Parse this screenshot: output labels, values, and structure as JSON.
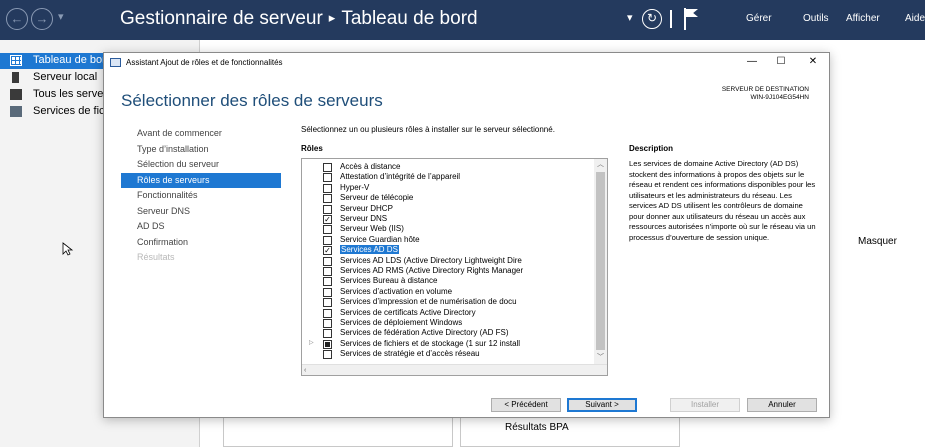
{
  "header": {
    "title_app": "Gestionnaire de serveur",
    "title_separator": "▸",
    "title_page": "Tableau de bord",
    "menu": [
      "Gérer",
      "Outils",
      "Afficher",
      "Aide"
    ]
  },
  "left_nav": {
    "items": [
      {
        "label": "Tableau de bord",
        "active": true,
        "icon": "dashboard-icon"
      },
      {
        "label": "Serveur local",
        "active": false,
        "icon": "server-icon"
      },
      {
        "label": "Tous les serveurs",
        "active": false,
        "icon": "servers-icon"
      },
      {
        "label": "Services de fichiers et de stockage",
        "active": false,
        "icon": "file-services-icon"
      }
    ]
  },
  "background": {
    "hide_label": "Masquer",
    "bpa_label": "Résultats BPA"
  },
  "dialog": {
    "title": "Assistant Ajout de rôles et de fonctionnalités",
    "heading": "Sélectionner des rôles de serveurs",
    "destination_label": "SERVEUR DE DESTINATION",
    "destination_server": "WIN-9J104EG54HN",
    "steps": [
      {
        "label": "Avant de commencer",
        "state": "normal"
      },
      {
        "label": "Type d’installation",
        "state": "normal"
      },
      {
        "label": "Sélection du serveur",
        "state": "normal"
      },
      {
        "label": "Rôles de serveurs",
        "state": "active"
      },
      {
        "label": "Fonctionnalités",
        "state": "normal"
      },
      {
        "label": "Serveur DNS",
        "state": "normal"
      },
      {
        "label": "AD DS",
        "state": "normal"
      },
      {
        "label": "Confirmation",
        "state": "normal"
      },
      {
        "label": "Résultats",
        "state": "disabled"
      }
    ],
    "instruction": "Sélectionnez un ou plusieurs rôles à installer sur le serveur sélectionné.",
    "roles_label": "Rôles",
    "roles": [
      {
        "label": "Accès à distance",
        "checked": false
      },
      {
        "label": "Attestation d’intégrité de l’appareil",
        "checked": false
      },
      {
        "label": "Hyper-V",
        "checked": false
      },
      {
        "label": "Serveur de télécopie",
        "checked": false
      },
      {
        "label": "Serveur DHCP",
        "checked": false
      },
      {
        "label": "Serveur DNS",
        "checked": true
      },
      {
        "label": "Serveur Web (IIS)",
        "checked": false
      },
      {
        "label": "Service Guardian hôte",
        "checked": false
      },
      {
        "label": "Services AD DS",
        "checked": true,
        "selected": true
      },
      {
        "label": "Services AD LDS (Active Directory Lightweight Dire",
        "checked": false
      },
      {
        "label": "Services AD RMS (Active Directory Rights Manager",
        "checked": false
      },
      {
        "label": "Services Bureau à distance",
        "checked": false
      },
      {
        "label": "Services d’activation en volume",
        "checked": false
      },
      {
        "label": "Services d’impression et de numérisation de docu",
        "checked": false
      },
      {
        "label": "Services de certificats Active Directory",
        "checked": false
      },
      {
        "label": "Services de déploiement Windows",
        "checked": false
      },
      {
        "label": "Services de fédération Active Directory (AD FS)",
        "checked": false
      },
      {
        "label": "Services de fichiers et de stockage (1 sur 12 install",
        "checked": "partial",
        "expandable": true
      },
      {
        "label": "Services de stratégie et d’accès réseau",
        "checked": false
      }
    ],
    "description_label": "Description",
    "description": "Les services de domaine Active Directory (AD DS) stockent des informations à propos des objets sur le réseau et rendent ces informations disponibles pour les utilisateurs et les administrateurs du réseau. Les services AD DS utilisent les contrôleurs de domaine pour donner aux utilisateurs du réseau un accès aux ressources autorisées n’importe où sur le réseau via un processus d’ouverture de session unique.",
    "buttons": {
      "previous": "< Précédent",
      "next": "Suivant >",
      "install": "Installer",
      "cancel": "Annuler"
    }
  }
}
